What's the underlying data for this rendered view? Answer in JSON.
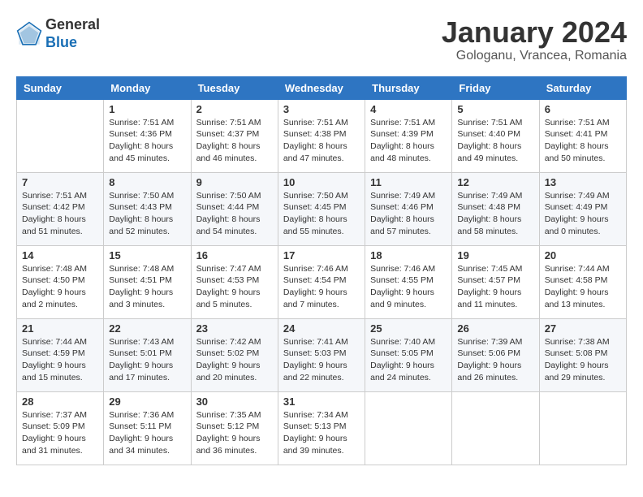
{
  "header": {
    "logo_general": "General",
    "logo_blue": "Blue",
    "month_title": "January 2024",
    "location": "Gologanu, Vrancea, Romania"
  },
  "days_of_week": [
    "Sunday",
    "Monday",
    "Tuesday",
    "Wednesday",
    "Thursday",
    "Friday",
    "Saturday"
  ],
  "weeks": [
    [
      {
        "day": "",
        "info": ""
      },
      {
        "day": "1",
        "info": "Sunrise: 7:51 AM\nSunset: 4:36 PM\nDaylight: 8 hours\nand 45 minutes."
      },
      {
        "day": "2",
        "info": "Sunrise: 7:51 AM\nSunset: 4:37 PM\nDaylight: 8 hours\nand 46 minutes."
      },
      {
        "day": "3",
        "info": "Sunrise: 7:51 AM\nSunset: 4:38 PM\nDaylight: 8 hours\nand 47 minutes."
      },
      {
        "day": "4",
        "info": "Sunrise: 7:51 AM\nSunset: 4:39 PM\nDaylight: 8 hours\nand 48 minutes."
      },
      {
        "day": "5",
        "info": "Sunrise: 7:51 AM\nSunset: 4:40 PM\nDaylight: 8 hours\nand 49 minutes."
      },
      {
        "day": "6",
        "info": "Sunrise: 7:51 AM\nSunset: 4:41 PM\nDaylight: 8 hours\nand 50 minutes."
      }
    ],
    [
      {
        "day": "7",
        "info": "Sunrise: 7:51 AM\nSunset: 4:42 PM\nDaylight: 8 hours\nand 51 minutes."
      },
      {
        "day": "8",
        "info": "Sunrise: 7:50 AM\nSunset: 4:43 PM\nDaylight: 8 hours\nand 52 minutes."
      },
      {
        "day": "9",
        "info": "Sunrise: 7:50 AM\nSunset: 4:44 PM\nDaylight: 8 hours\nand 54 minutes."
      },
      {
        "day": "10",
        "info": "Sunrise: 7:50 AM\nSunset: 4:45 PM\nDaylight: 8 hours\nand 55 minutes."
      },
      {
        "day": "11",
        "info": "Sunrise: 7:49 AM\nSunset: 4:46 PM\nDaylight: 8 hours\nand 57 minutes."
      },
      {
        "day": "12",
        "info": "Sunrise: 7:49 AM\nSunset: 4:48 PM\nDaylight: 8 hours\nand 58 minutes."
      },
      {
        "day": "13",
        "info": "Sunrise: 7:49 AM\nSunset: 4:49 PM\nDaylight: 9 hours\nand 0 minutes."
      }
    ],
    [
      {
        "day": "14",
        "info": "Sunrise: 7:48 AM\nSunset: 4:50 PM\nDaylight: 9 hours\nand 2 minutes."
      },
      {
        "day": "15",
        "info": "Sunrise: 7:48 AM\nSunset: 4:51 PM\nDaylight: 9 hours\nand 3 minutes."
      },
      {
        "day": "16",
        "info": "Sunrise: 7:47 AM\nSunset: 4:53 PM\nDaylight: 9 hours\nand 5 minutes."
      },
      {
        "day": "17",
        "info": "Sunrise: 7:46 AM\nSunset: 4:54 PM\nDaylight: 9 hours\nand 7 minutes."
      },
      {
        "day": "18",
        "info": "Sunrise: 7:46 AM\nSunset: 4:55 PM\nDaylight: 9 hours\nand 9 minutes."
      },
      {
        "day": "19",
        "info": "Sunrise: 7:45 AM\nSunset: 4:57 PM\nDaylight: 9 hours\nand 11 minutes."
      },
      {
        "day": "20",
        "info": "Sunrise: 7:44 AM\nSunset: 4:58 PM\nDaylight: 9 hours\nand 13 minutes."
      }
    ],
    [
      {
        "day": "21",
        "info": "Sunrise: 7:44 AM\nSunset: 4:59 PM\nDaylight: 9 hours\nand 15 minutes."
      },
      {
        "day": "22",
        "info": "Sunrise: 7:43 AM\nSunset: 5:01 PM\nDaylight: 9 hours\nand 17 minutes."
      },
      {
        "day": "23",
        "info": "Sunrise: 7:42 AM\nSunset: 5:02 PM\nDaylight: 9 hours\nand 20 minutes."
      },
      {
        "day": "24",
        "info": "Sunrise: 7:41 AM\nSunset: 5:03 PM\nDaylight: 9 hours\nand 22 minutes."
      },
      {
        "day": "25",
        "info": "Sunrise: 7:40 AM\nSunset: 5:05 PM\nDaylight: 9 hours\nand 24 minutes."
      },
      {
        "day": "26",
        "info": "Sunrise: 7:39 AM\nSunset: 5:06 PM\nDaylight: 9 hours\nand 26 minutes."
      },
      {
        "day": "27",
        "info": "Sunrise: 7:38 AM\nSunset: 5:08 PM\nDaylight: 9 hours\nand 29 minutes."
      }
    ],
    [
      {
        "day": "28",
        "info": "Sunrise: 7:37 AM\nSunset: 5:09 PM\nDaylight: 9 hours\nand 31 minutes."
      },
      {
        "day": "29",
        "info": "Sunrise: 7:36 AM\nSunset: 5:11 PM\nDaylight: 9 hours\nand 34 minutes."
      },
      {
        "day": "30",
        "info": "Sunrise: 7:35 AM\nSunset: 5:12 PM\nDaylight: 9 hours\nand 36 minutes."
      },
      {
        "day": "31",
        "info": "Sunrise: 7:34 AM\nSunset: 5:13 PM\nDaylight: 9 hours\nand 39 minutes."
      },
      {
        "day": "",
        "info": ""
      },
      {
        "day": "",
        "info": ""
      },
      {
        "day": "",
        "info": ""
      }
    ]
  ]
}
